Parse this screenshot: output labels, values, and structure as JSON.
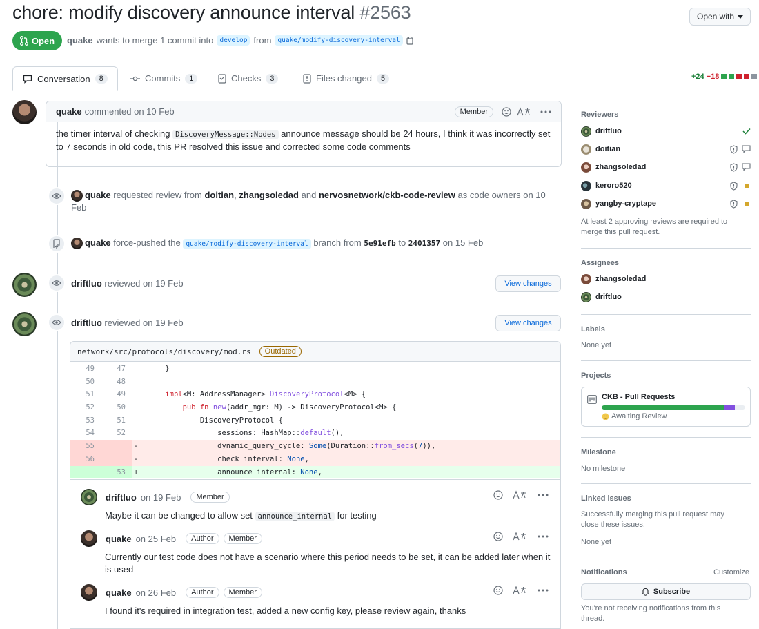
{
  "header": {
    "title": "chore: modify discovery announce interval",
    "number": "#2563",
    "open_with_label": "Open with",
    "state_label": "Open",
    "author": "quake",
    "merge_text": "wants to merge 1 commit into",
    "base_branch": "develop",
    "from_text": "from",
    "head_branch": "quake/modify-discovery-interval"
  },
  "tabs": [
    {
      "label": "Conversation",
      "count": "8"
    },
    {
      "label": "Commits",
      "count": "1"
    },
    {
      "label": "Checks",
      "count": "3"
    },
    {
      "label": "Files changed",
      "count": "5"
    }
  ],
  "diffstat": {
    "additions": "+24",
    "deletions": "−18"
  },
  "timeline": {
    "first_comment": {
      "author": "quake",
      "meta": "commented on 10 Feb",
      "badge": "Member",
      "body_1": "the timer interval of checking",
      "body_code": "DiscoveryMessage::Nodes",
      "body_2": "announce message should be 24 hours, I think it was incorrectly set to 7 seconds in old code, this PR resolved this issue and corrected some code comments"
    },
    "review_request": {
      "actor": "quake",
      "text_1": "requested review from",
      "r1": "doitian",
      "r2": "zhangsoledad",
      "text_and": "and",
      "r3": "nervosnetwork/ckb-code-review",
      "text_2": "as code owners",
      "date": "on 10 Feb"
    },
    "force_push": {
      "actor": "quake",
      "text_1": "force-pushed the",
      "branch": "quake/modify-discovery-interval",
      "text_2": "branch from",
      "from_sha": "5e91efb",
      "text_to": "to",
      "to_sha": "2401357",
      "date": "on 15 Feb"
    },
    "review_1": {
      "author": "driftluo",
      "meta": "reviewed on 19 Feb",
      "button": "View changes"
    },
    "review_2": {
      "author": "driftluo",
      "meta": "reviewed on 19 Feb",
      "button": "View changes"
    }
  },
  "diff": {
    "file": "network/src/protocols/discovery/mod.rs",
    "badge": "Outdated",
    "lines": [
      {
        "old": "49",
        "new": "47",
        "sign": "",
        "code": "    }"
      },
      {
        "old": "50",
        "new": "48",
        "sign": "",
        "code": ""
      },
      {
        "old": "51",
        "new": "49",
        "sign": "",
        "code": "    impl<M: AddressManager> DiscoveryProtocol<M> {"
      },
      {
        "old": "52",
        "new": "50",
        "sign": "",
        "code": "        pub fn new(addr_mgr: M) -> DiscoveryProtocol<M> {"
      },
      {
        "old": "53",
        "new": "51",
        "sign": "",
        "code": "            DiscoveryProtocol {"
      },
      {
        "old": "54",
        "new": "52",
        "sign": "",
        "code": "                sessions: HashMap::default(),"
      },
      {
        "old": "55",
        "new": "",
        "sign": "-",
        "code": "                dynamic_query_cycle: Some(Duration::from_secs(7)),"
      },
      {
        "old": "56",
        "new": "",
        "sign": "-",
        "code": "                check_interval: None,"
      },
      {
        "old": "",
        "new": "53",
        "sign": "+",
        "code": "                announce_internal: None,"
      }
    ]
  },
  "replies": [
    {
      "author": "driftluo",
      "date": "on 19 Feb",
      "badges": [
        "Member"
      ],
      "body_1": "Maybe it can be changed to allow set",
      "body_code": "announce_internal",
      "body_2": "for testing"
    },
    {
      "author": "quake",
      "date": "on 25 Feb",
      "badges": [
        "Author",
        "Member"
      ],
      "body_1": "Currently our test code does not have a scenario where this period needs to be set, it can be added later when it is used"
    },
    {
      "author": "quake",
      "date": "on 26 Feb",
      "badges": [
        "Author",
        "Member"
      ],
      "body_1": "I found it's required in integration test, added a new config key, please review again, thanks"
    }
  ],
  "sidebar": {
    "reviewers_title": "Reviewers",
    "reviewers": [
      {
        "name": "driftluo",
        "status": "approved"
      },
      {
        "name": "doitian",
        "status": "code-owner-commented"
      },
      {
        "name": "zhangsoledad",
        "status": "code-owner-commented"
      },
      {
        "name": "keroro520",
        "status": "code-owner-pending"
      },
      {
        "name": "yangby-cryptape",
        "status": "code-owner-pending"
      }
    ],
    "reviewers_note": "At least 2 approving reviews are required to merge this pull request.",
    "assignees_title": "Assignees",
    "assignees": [
      "zhangsoledad",
      "driftluo"
    ],
    "labels_title": "Labels",
    "labels_value": "None yet",
    "projects_title": "Projects",
    "project_name": "CKB - Pull Requests",
    "project_status": "Awaiting Review",
    "milestone_title": "Milestone",
    "milestone_value": "No milestone",
    "linked_title": "Linked issues",
    "linked_note": "Successfully merging this pull request may close these issues.",
    "linked_value": "None yet",
    "notifications_title": "Notifications",
    "customize_label": "Customize",
    "subscribe_label": "Subscribe",
    "notifications_note": "You're not receiving notifications from this thread."
  },
  "colors": {
    "green": "#2da44e",
    "accent": "#0969da",
    "danger": "#cf222e",
    "pending": "#d4a72c"
  }
}
